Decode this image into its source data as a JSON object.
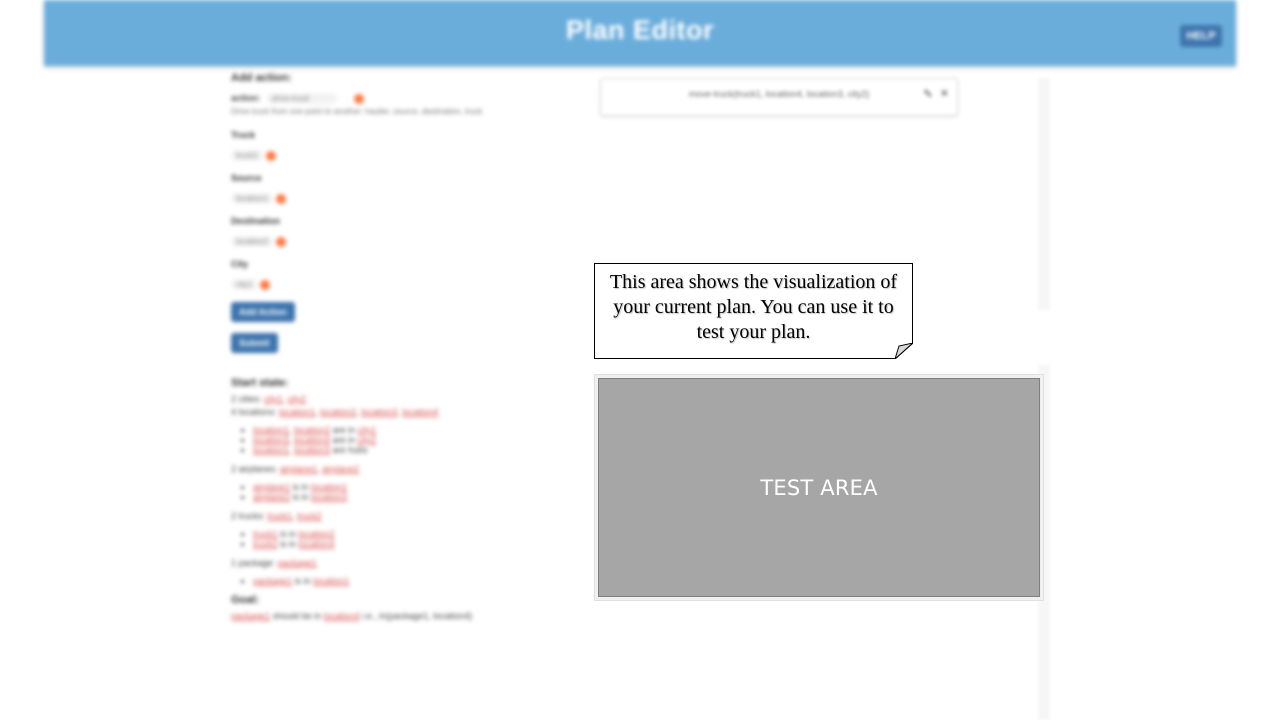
{
  "header": {
    "title": "Plan Editor",
    "help_label": "HELP"
  },
  "add_action": {
    "heading": "Add action:",
    "action_label": "action:",
    "action_value": "drive-truck",
    "action_desc": "Drive truck from one point to another: haulier, source, destination, truck",
    "fields": [
      {
        "label": "Truck",
        "value": "truck1"
      },
      {
        "label": "Source",
        "value": "location1"
      },
      {
        "label": "Destination",
        "value": "location2"
      },
      {
        "label": "City",
        "value": "city1"
      }
    ],
    "add_button": "Add Action",
    "submit_button": "Submit"
  },
  "start_state": {
    "heading": "Start state:",
    "cities_label": "2 cities:",
    "cities": [
      "city1",
      "city2"
    ],
    "locations_label": "4 locations:",
    "locations": [
      "location1",
      "location2",
      "location3",
      "location4"
    ],
    "location_items": [
      {
        "a": "location1",
        "b": "location2",
        "rel": "are in",
        "target": "city1"
      },
      {
        "a": "location3",
        "b": "location4",
        "rel": "are in",
        "target": "city2"
      },
      {
        "a": "location1",
        "b": "location3",
        "rel": "are hubs",
        "target": ""
      }
    ],
    "airplanes_label": "2 airplanes:",
    "airplanes": [
      "airplane1",
      "airplane2"
    ],
    "airplane_items": [
      {
        "a": "airplane1",
        "rel": "is in",
        "target": "location1"
      },
      {
        "a": "airplane2",
        "rel": "is in",
        "target": "location3"
      }
    ],
    "trucks_label": "2 trucks:",
    "trucks": [
      "truck1",
      "truck2"
    ],
    "truck_items": [
      {
        "a": "truck1",
        "rel": "is in",
        "target": "location2"
      },
      {
        "a": "truck2",
        "rel": "is in",
        "target": "location4"
      }
    ],
    "package_label": "1 package:",
    "packages": [
      "package1"
    ],
    "package_items": [
      {
        "a": "package1",
        "rel": "is in",
        "target": "location1"
      }
    ]
  },
  "goal": {
    "heading": "Goal:",
    "item_a": "package1",
    "rel": "should be in",
    "target": "location4",
    "suffix": "i.e., in(package1, location4)"
  },
  "plan": {
    "step_text": "move-truck(truck1, location4, location3, city2)"
  },
  "callout": {
    "text": "This area shows the visualization of your current plan. You can use it to test your plan."
  },
  "test_area": {
    "label": "TEST AREA"
  }
}
